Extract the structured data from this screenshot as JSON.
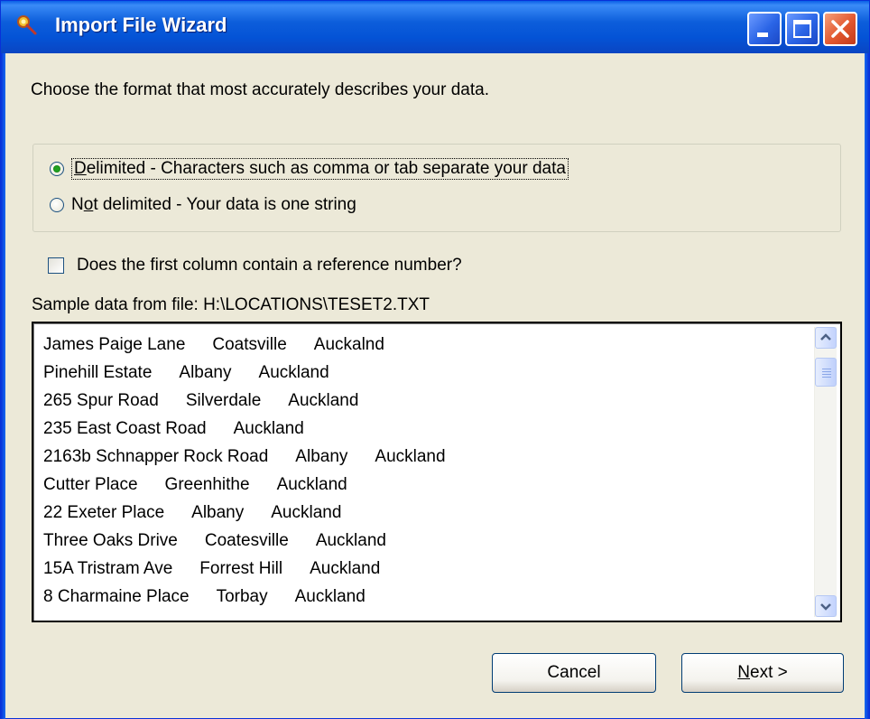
{
  "window": {
    "title": "Import File Wizard",
    "app_icon": "magnifier-key-icon",
    "controls": [
      "minimize-icon",
      "maximize-icon",
      "close-icon"
    ]
  },
  "instruction": "Choose the format that most accurately describes your data.",
  "format_options": [
    {
      "mnemonic": "D",
      "rest": "elimited - Characters such as comma or tab separate your data",
      "checked": true
    },
    {
      "prefix": "N",
      "mnemonic": "o",
      "rest": "t delimited - Your data is one string",
      "checked": false
    }
  ],
  "reference_checkbox": {
    "label": "Does the first column contain a reference number?",
    "checked": false
  },
  "sample": {
    "label": "Sample data from file: H:\\LOCATIONS\\TESET2.TXT",
    "rows": [
      [
        "James Paige Lane",
        "Coatsville",
        "Auckalnd"
      ],
      [
        "Pinehill Estate",
        "Albany",
        "Auckland"
      ],
      [
        "265 Spur Road",
        "Silverdale",
        "Auckland"
      ],
      [
        "235 East Coast Road",
        "Auckland"
      ],
      [
        "2163b Schnapper Rock Road",
        "Albany",
        "Auckland"
      ],
      [
        "Cutter Place",
        "Greenhithe",
        "Auckland"
      ],
      [
        "22 Exeter Place",
        "Albany",
        "Auckland"
      ],
      [
        "Three Oaks Drive",
        "Coatesville",
        "Auckland"
      ],
      [
        "15A Tristram Ave",
        "Forrest Hill",
        "Auckland"
      ],
      [
        "8 Charmaine Place",
        "Torbay",
        "Auckland"
      ]
    ]
  },
  "buttons": {
    "cancel": "Cancel",
    "next_mnemonic": "N",
    "next_rest": "ext >"
  }
}
